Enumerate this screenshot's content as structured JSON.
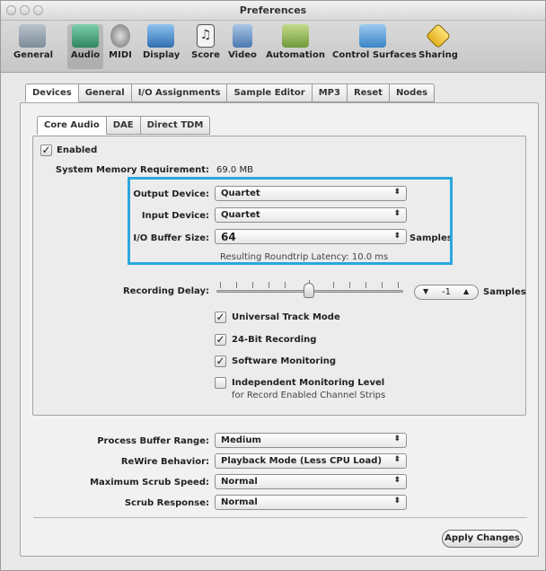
{
  "window": {
    "title": "Preferences"
  },
  "toolbar": {
    "items": [
      {
        "label": "General",
        "icon": "switch-icon",
        "color": "#7d8c99"
      },
      {
        "label": "Audio",
        "icon": "audio-icon",
        "color": "#3f9a77"
      },
      {
        "label": "MIDI",
        "icon": "midi-icon",
        "color": "#6d6d6d"
      },
      {
        "label": "Display",
        "icon": "display-icon",
        "color": "#3b82c8"
      },
      {
        "label": "Score",
        "icon": "score-icon",
        "color": "#555555"
      },
      {
        "label": "Video",
        "icon": "video-icon",
        "color": "#4a78b0"
      },
      {
        "label": "Automation",
        "icon": "automation-icon",
        "color": "#6f9a3a"
      },
      {
        "label": "Control Surfaces",
        "icon": "control-surfaces-icon",
        "color": "#3a84c6"
      },
      {
        "label": "Sharing",
        "icon": "sharing-icon",
        "color": "#e3b21d"
      }
    ],
    "selected": "Audio"
  },
  "tabs": [
    "Devices",
    "General",
    "I/O Assignments",
    "Sample Editor",
    "MP3",
    "Reset",
    "Nodes"
  ],
  "subtabs": [
    "Core Audio",
    "DAE",
    "Direct TDM"
  ],
  "core_audio": {
    "enabled_label": "Enabled",
    "enabled": true,
    "sys_mem_label": "System Memory Requirement:",
    "sys_mem_value": "69.0 MB",
    "output_device_label": "Output Device:",
    "output_device_value": "Quartet",
    "input_device_label": "Input Device:",
    "input_device_value": "Quartet",
    "buffer_size_label": "I/O Buffer Size:",
    "buffer_size_value": "64",
    "buffer_size_unit": "Samples",
    "latency_text": "Resulting Roundtrip Latency: 10.0 ms",
    "recording_delay_label": "Recording Delay:",
    "recording_delay_value": "-1",
    "recording_delay_unit": "Samples",
    "checkboxes": [
      {
        "label": "Universal Track Mode",
        "checked": true
      },
      {
        "label": "24-Bit Recording",
        "checked": true
      },
      {
        "label": "Software Monitoring",
        "checked": true
      },
      {
        "label": "Independent Monitoring Level",
        "checked": false
      }
    ],
    "independent_sublabel": "for Record Enabled Channel Strips"
  },
  "bottom": {
    "process_buffer_label": "Process Buffer Range:",
    "process_buffer_value": "Medium",
    "rewire_label": "ReWire Behavior:",
    "rewire_value": "Playback Mode (Less CPU Load)",
    "scrub_speed_label": "Maximum Scrub Speed:",
    "scrub_speed_value": "Normal",
    "scrub_response_label": "Scrub Response:",
    "scrub_response_value": "Normal",
    "apply_label": "Apply Changes"
  },
  "colors": {
    "highlight": "#2aa7e0"
  }
}
